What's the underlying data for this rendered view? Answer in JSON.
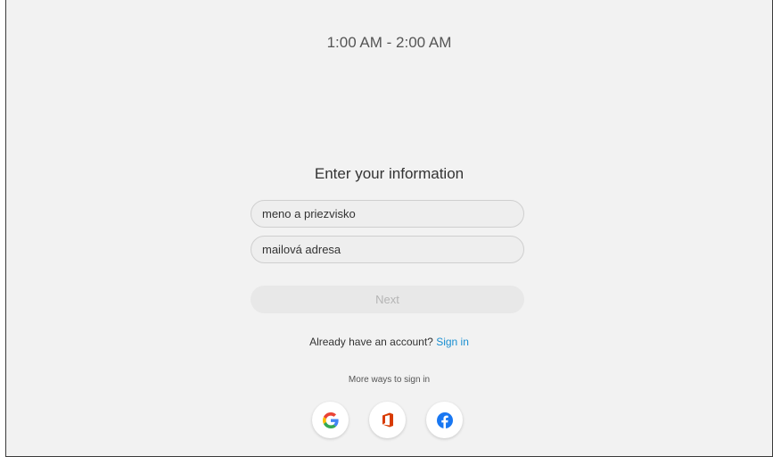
{
  "header": {
    "time_range": "1:00 AM - 2:00 AM"
  },
  "form": {
    "heading": "Enter your information",
    "name_placeholder": "meno a priezvisko",
    "email_placeholder": "mailová adresa",
    "next_label": "Next"
  },
  "signin": {
    "prompt": "Already have an account?",
    "link_label": "Sign in"
  },
  "more_ways": {
    "label": "More ways to sign in",
    "providers": [
      "google-icon",
      "office-icon",
      "facebook-icon"
    ]
  },
  "colors": {
    "background": "#f2f2f2",
    "link": "#1a8fd1",
    "office": "#d83b01",
    "facebook": "#1877f2"
  }
}
